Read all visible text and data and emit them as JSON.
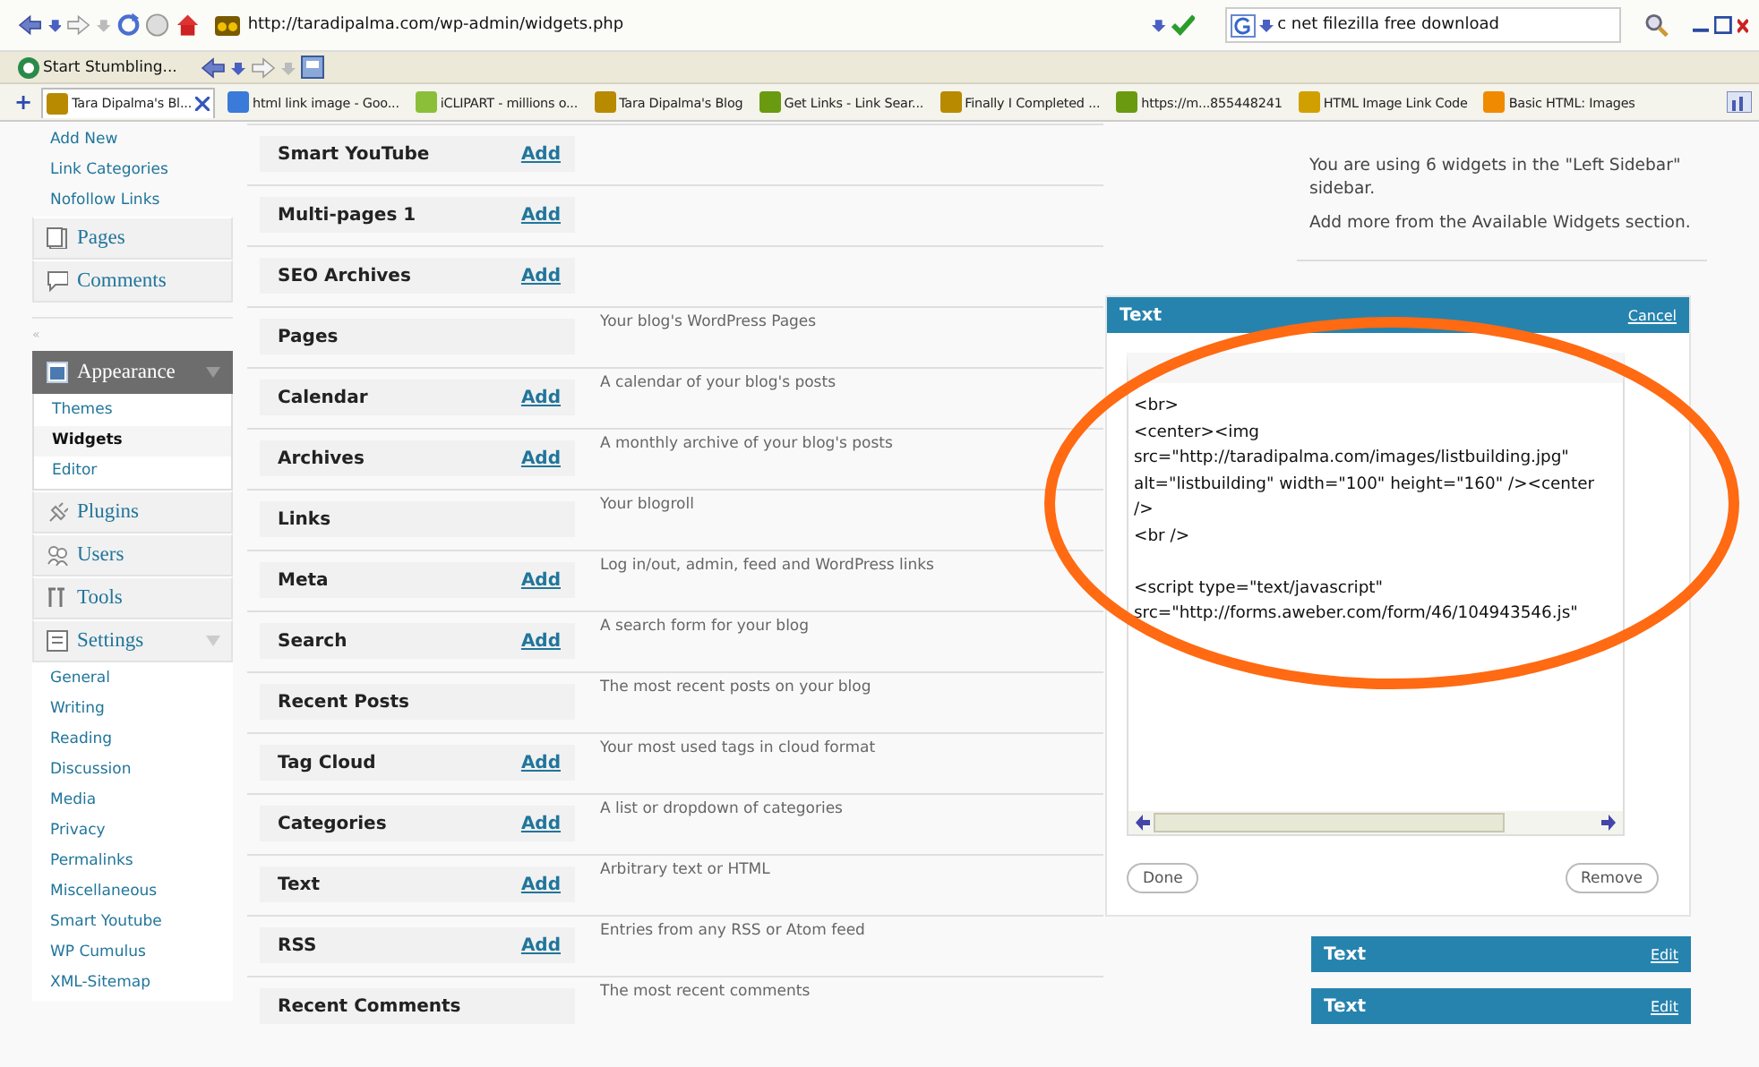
{
  "browser": {
    "url": "http://taradipalma.com/wp-admin/widgets.php",
    "search_value": "c net filezilla free download",
    "toolbar_label": "Start Stumbling...",
    "new_tab_label": "+",
    "tabs": [
      {
        "label": "Tara Dipalma's Bl...",
        "selected": true
      },
      {
        "label": "html link image - Goo...",
        "selected": false
      },
      {
        "label": "iCLIPART - millions o...",
        "selected": false
      },
      {
        "label": "Tara Dipalma's Blog",
        "selected": false
      },
      {
        "label": "Get Links - Link Sear...",
        "selected": false
      },
      {
        "label": "Finally I Completed ...",
        "selected": false
      },
      {
        "label": "https://m...855448241",
        "selected": false
      },
      {
        "label": "HTML Image Link Code",
        "selected": false
      },
      {
        "label": "Basic HTML: Images",
        "selected": false
      }
    ]
  },
  "sidebar": {
    "items": [
      {
        "kind": "sub",
        "label": "Add New",
        "selected": false
      },
      {
        "kind": "sub",
        "label": "Link Categories",
        "selected": false
      },
      {
        "kind": "sub",
        "label": "Nofollow Links",
        "selected": false
      },
      {
        "kind": "menu",
        "label": "Pages",
        "expanded": false,
        "current": false
      },
      {
        "kind": "menu",
        "label": "Comments",
        "expanded": false,
        "current": false
      },
      {
        "kind": "collapse",
        "label": "«"
      },
      {
        "kind": "menu",
        "label": "Appearance",
        "expanded": true,
        "current": true,
        "children": [
          {
            "label": "Themes",
            "selected": false
          },
          {
            "label": "Widgets",
            "selected": true
          },
          {
            "label": "Editor",
            "selected": false
          }
        ]
      },
      {
        "kind": "menu",
        "label": "Plugins",
        "expanded": false,
        "current": false
      },
      {
        "kind": "menu",
        "label": "Users",
        "expanded": false,
        "current": false
      },
      {
        "kind": "menu",
        "label": "Tools",
        "expanded": false,
        "current": false
      },
      {
        "kind": "menu",
        "label": "Settings",
        "expanded": true,
        "current": false,
        "children": [
          {
            "label": "General",
            "selected": false
          },
          {
            "label": "Writing",
            "selected": false
          },
          {
            "label": "Reading",
            "selected": false
          },
          {
            "label": "Discussion",
            "selected": false
          },
          {
            "label": "Media",
            "selected": false
          },
          {
            "label": "Privacy",
            "selected": false
          },
          {
            "label": "Permalinks",
            "selected": false
          },
          {
            "label": "Miscellaneous",
            "selected": false
          },
          {
            "label": "Smart Youtube",
            "selected": false
          },
          {
            "label": "WP Cumulus",
            "selected": false
          },
          {
            "label": "XML-Sitemap",
            "selected": false
          }
        ]
      }
    ]
  },
  "widgets": [
    {
      "title": "Smart YouTube",
      "add": "Add"
    },
    {
      "title": "Multi-pages 1",
      "add": "Add"
    },
    {
      "title": "SEO Archives",
      "add": "Add"
    },
    {
      "title": "Pages",
      "description": "Your blog's WordPress Pages"
    },
    {
      "title": "Calendar",
      "add": "Add",
      "description": "A calendar of your blog's posts"
    },
    {
      "title": "Archives",
      "add": "Add",
      "description": "A monthly archive of your blog's posts"
    },
    {
      "title": "Links",
      "description": "Your blogroll"
    },
    {
      "title": "Meta",
      "add": "Add",
      "description": "Log in/out, admin, feed and WordPress links"
    },
    {
      "title": "Search",
      "add": "Add",
      "description": "A search form for your blog"
    },
    {
      "title": "Recent Posts",
      "description": "The most recent posts on your blog"
    },
    {
      "title": "Tag Cloud",
      "add": "Add",
      "description": "Your most used tags in cloud format"
    },
    {
      "title": "Categories",
      "add": "Add",
      "description": "A list or dropdown of categories"
    },
    {
      "title": "Text",
      "add": "Add",
      "description": "Arbitrary text or HTML"
    },
    {
      "title": "RSS",
      "add": "Add",
      "description": "Entries from any RSS or Atom feed"
    },
    {
      "title": "Recent Comments",
      "description": "The most recent comments"
    }
  ],
  "sidebar_info": [
    "You are using 6 widgets in the \"Left Sidebar\" sidebar.",
    "Add more from the Available Widgets section."
  ],
  "editor": {
    "title": "Text",
    "cancel": "Cancel",
    "blocks": [
      "<br>\n<center><img\nsrc=\"http://taradipalma.com/images/listbuilding.jpg\"\nalt=\"listbuilding\" width=\"100\" height=\"160\" /><center\n/>\n<br />",
      "<script type=\"text/javascript\"\nsrc=\"http://forms.aweber.com/form/46/104943546.js\""
    ],
    "done": "Done",
    "remove": "Remove"
  },
  "placed_widgets": [
    {
      "title": "Text",
      "action": "Edit"
    },
    {
      "title": "Text",
      "action": "Edit"
    }
  ]
}
